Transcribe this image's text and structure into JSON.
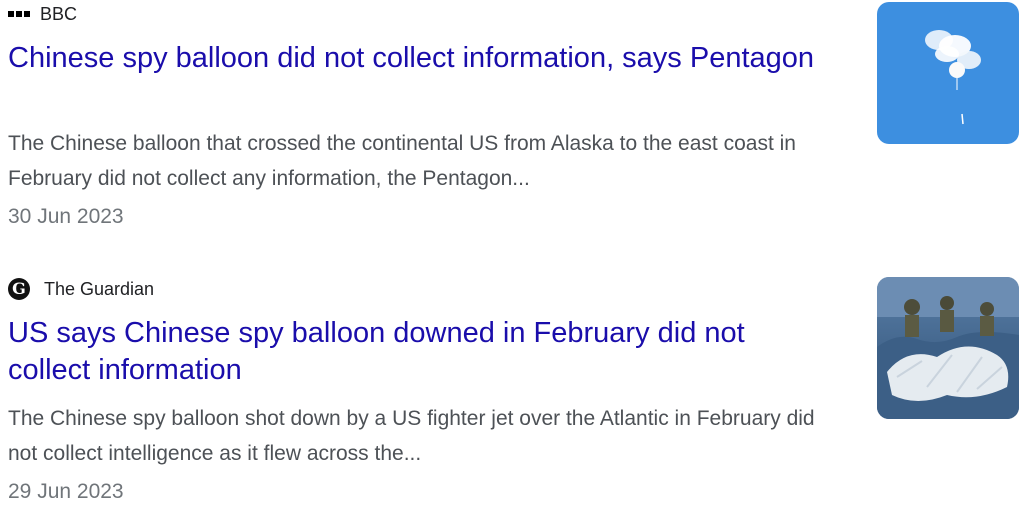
{
  "articles": [
    {
      "source": "BBC",
      "source_icon": "bbc-logo-icon",
      "headline": "Chinese spy balloon did not collect information, says Pentagon",
      "snippet": "The Chinese balloon that crossed the continental US from Alaska to the east coast in February did not collect any information, the Pentagon...",
      "date": "30 Jun 2023",
      "thumbnail_icon": "balloon-in-sky-image"
    },
    {
      "source": "The Guardian",
      "source_icon": "guardian-logo-icon",
      "source_logo_glyph": "G",
      "headline": "US says Chinese spy balloon downed in February did not collect information",
      "snippet": "The Chinese spy balloon shot down by a US fighter jet over the Atlantic in February did not collect intelligence as it flew across the...",
      "date": "29 Jun 2023",
      "thumbnail_icon": "balloon-debris-recovery-image"
    }
  ],
  "colors": {
    "headline": "#1a0dab",
    "snippet": "#4d5156",
    "date": "#70757a",
    "sky": "#3d8fe0"
  }
}
